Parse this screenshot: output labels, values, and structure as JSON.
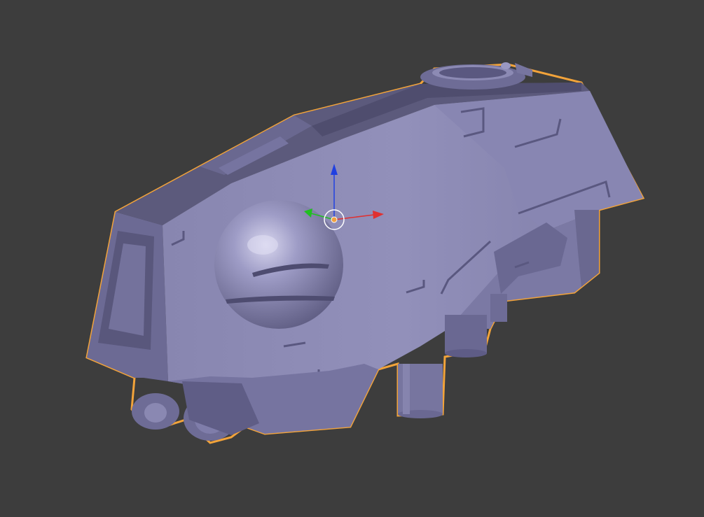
{
  "viewport": {
    "background": "#3d3d3d",
    "mesh_color": "#8a88b2",
    "selection_outline_color": "#f2a33a"
  },
  "gizmo": {
    "axes": [
      {
        "axis": "x",
        "color": "#e03030",
        "icon": "arrow-right-icon"
      },
      {
        "axis": "y",
        "color": "#20c020",
        "icon": "arrow-left-icon"
      },
      {
        "axis": "z",
        "color": "#2040e0",
        "icon": "arrow-up-icon"
      }
    ],
    "origin_color": "#f0a040"
  }
}
